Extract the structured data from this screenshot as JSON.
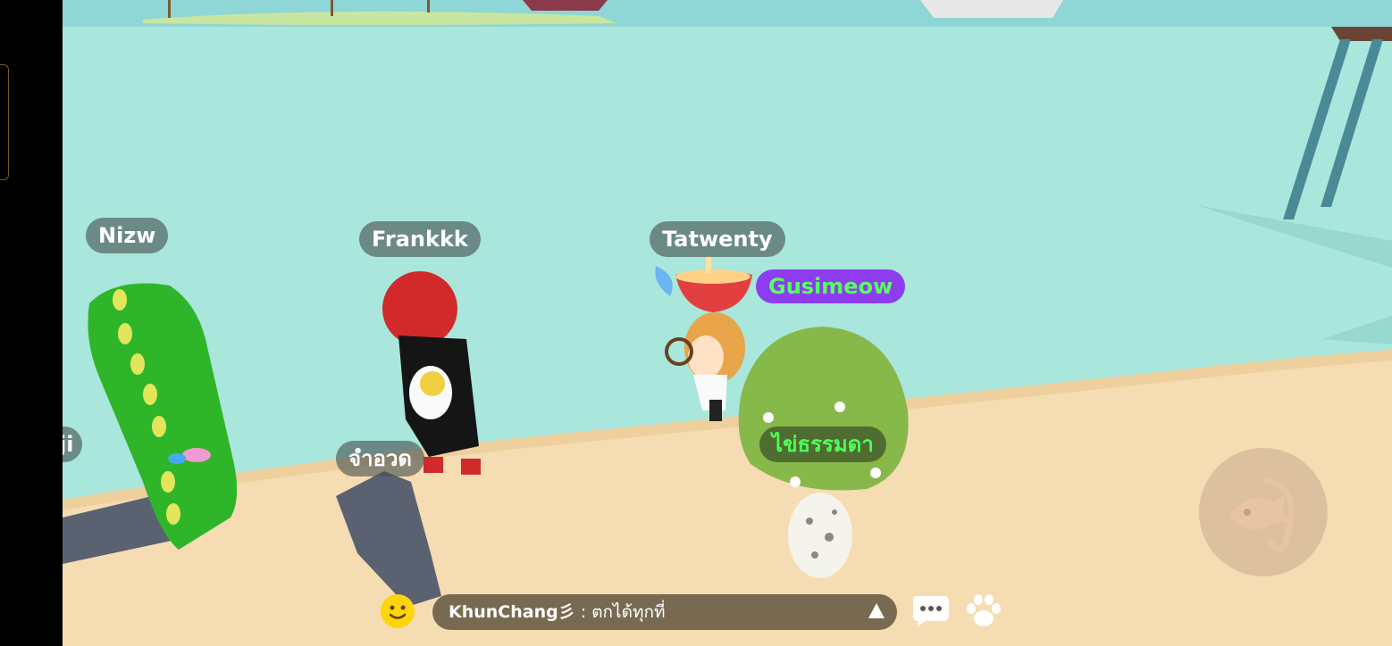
{
  "players": {
    "nizw": "Nizw",
    "frankkk": "Frankkk",
    "tatwenty": "Tatwenty",
    "gusimeow": "Gusimeow",
    "jamuad": "จำอวด",
    "kaitammada": "ไข่ธรรมดา",
    "partial_left": "ji"
  },
  "chat": {
    "sender": "KhunChang彡",
    "separator": " : ",
    "message": "ตกได้ทุกที่"
  },
  "icons": {
    "fishing": "fishing-rod-icon",
    "emoji": "smiley-icon",
    "chat": "speech-bubble-icon",
    "pet": "paw-icon",
    "expand": "triangle-up-icon"
  },
  "colors": {
    "sea": "#a9e6dc",
    "sand": "#f6dcb2",
    "purple_tag": "#8e3cf0",
    "green_name": "#4dff55"
  }
}
